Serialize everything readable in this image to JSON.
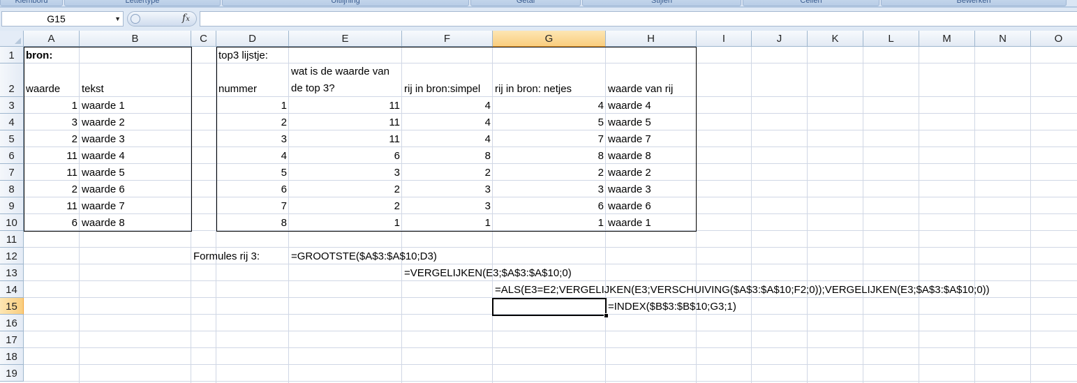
{
  "ribbon": {
    "groups": [
      "Klembord",
      "Lettertype",
      "Uitlijning",
      "Getal",
      "Stijlen",
      "Cellen",
      "Bewerken"
    ]
  },
  "formula_bar": {
    "name_box": "G15",
    "fx_label": "fx",
    "formula": ""
  },
  "columns": [
    "A",
    "B",
    "C",
    "D",
    "E",
    "F",
    "G",
    "H",
    "I",
    "J",
    "K",
    "L",
    "M",
    "N",
    "O"
  ],
  "rows": [
    "1",
    "2",
    "3",
    "4",
    "5",
    "6",
    "7",
    "8",
    "9",
    "10",
    "11",
    "12",
    "13",
    "14",
    "15",
    "16",
    "17",
    "18",
    "19"
  ],
  "selected": {
    "column": "G",
    "row": "15"
  },
  "sheet": {
    "A1": "bron:",
    "D1": "top3 lijstje:",
    "A2": "waarde",
    "B2": "tekst",
    "D2": "nummer",
    "E2": "wat is de waarde van de top 3?",
    "F2": "rij in bron:simpel",
    "G2": "rij in bron: netjes",
    "H2": "waarde van rij",
    "source": {
      "waarde": [
        "1",
        "3",
        "2",
        "11",
        "11",
        "2",
        "11",
        "6"
      ],
      "tekst": [
        "waarde 1",
        "waarde 2",
        "waarde 3",
        "waarde 4",
        "waarde 5",
        "waarde 6",
        "waarde 7",
        "waarde 8"
      ]
    },
    "top3": {
      "nummer": [
        "1",
        "2",
        "3",
        "4",
        "5",
        "6",
        "7",
        "8"
      ],
      "waarde": [
        "11",
        "11",
        "11",
        "6",
        "3",
        "2",
        "2",
        "1"
      ],
      "simpel": [
        "4",
        "4",
        "4",
        "8",
        "2",
        "3",
        "3",
        "1"
      ],
      "netjes": [
        "4",
        "5",
        "7",
        "8",
        "2",
        "3",
        "6",
        "1"
      ],
      "tekst": [
        "waarde 4",
        "waarde 5",
        "waarde 7",
        "waarde 8",
        "waarde 2",
        "waarde 3",
        "waarde 6",
        "waarde 1"
      ]
    },
    "C12": "Formules rij 3:",
    "E12": "=GROOTSTE($A$3:$A$10;D3)",
    "F13": "=VERGELIJKEN(E3;$A$3:$A$10;0)",
    "G14": "=ALS(E3=E2;VERGELIJKEN(E3;VERSCHUIVING($A$3:$A$10;F2;0));VERGELIJKEN(E3;$A$3:$A$10;0))",
    "H15": "=INDEX($B$3:$B$10;G3;1)"
  }
}
